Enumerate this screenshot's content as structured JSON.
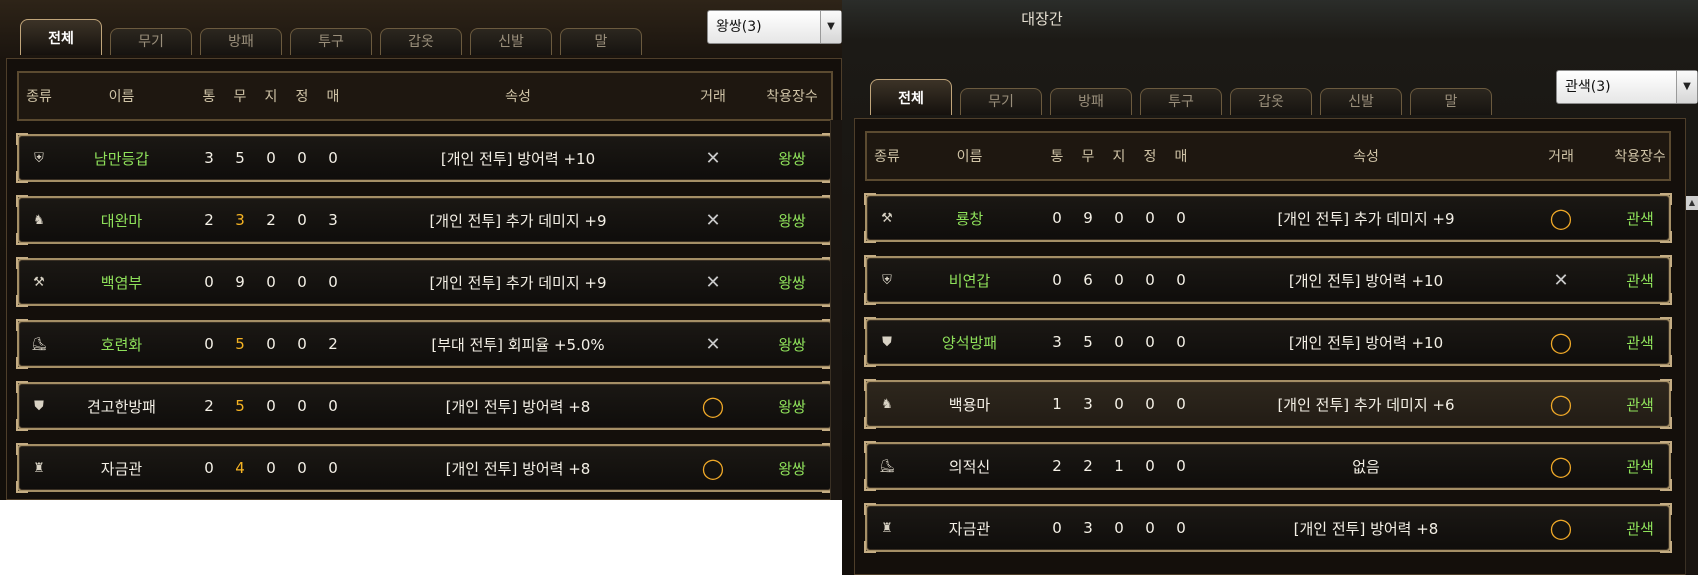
{
  "left": {
    "tabs": [
      "전체",
      "무기",
      "방패",
      "투구",
      "갑옷",
      "신발",
      "말"
    ],
    "dropdown": "왕쌍(3)",
    "headers": {
      "type": "종류",
      "name": "이름",
      "s1": "통",
      "s2": "무",
      "s3": "지",
      "s4": "정",
      "s5": "매",
      "attr": "속성",
      "trade": "거래",
      "owner": "착용장수"
    },
    "rows": [
      {
        "icon": "armor-icon",
        "name": "남만등갑",
        "green": true,
        "stats": [
          "3",
          "5",
          "0",
          "0",
          "0"
        ],
        "orange": [],
        "attr": "[개인 전투] 방어력 +10",
        "trade": "untradeable",
        "owner": "왕쌍"
      },
      {
        "icon": "horse-icon",
        "name": "대완마",
        "green": true,
        "stats": [
          "2",
          "3",
          "2",
          "0",
          "3"
        ],
        "orange": [
          1
        ],
        "attr": "[개인 전투] 추가 데미지 +9",
        "trade": "untradeable",
        "owner": "왕쌍"
      },
      {
        "icon": "weapon-icon",
        "name": "백염부",
        "green": true,
        "stats": [
          "0",
          "9",
          "0",
          "0",
          "0"
        ],
        "orange": [],
        "attr": "[개인 전투] 추가 데미지 +9",
        "trade": "untradeable",
        "owner": "왕쌍"
      },
      {
        "icon": "boots-icon",
        "name": "호련화",
        "green": true,
        "stats": [
          "0",
          "5",
          "0",
          "0",
          "2"
        ],
        "orange": [
          1
        ],
        "attr": "[부대 전투] 회피율 +5.0%",
        "trade": "untradeable",
        "owner": "왕쌍"
      },
      {
        "icon": "shield-icon",
        "name": "견고한방패",
        "green": false,
        "stats": [
          "2",
          "5",
          "0",
          "0",
          "0"
        ],
        "orange": [
          1
        ],
        "attr": "[개인 전투] 방어력 +8",
        "trade": "tradeable",
        "owner": "왕쌍"
      },
      {
        "icon": "helmet-icon",
        "name": "자금관",
        "green": false,
        "stats": [
          "0",
          "4",
          "0",
          "0",
          "0"
        ],
        "orange": [
          1
        ],
        "attr": "[개인 전투] 방어력 +8",
        "trade": "tradeable",
        "owner": "왕쌍"
      }
    ]
  },
  "right": {
    "window_title": "대장간",
    "tabs": [
      "전체",
      "무기",
      "방패",
      "투구",
      "갑옷",
      "신발",
      "말"
    ],
    "dropdown": "관색(3)",
    "headers": {
      "type": "종류",
      "name": "이름",
      "s1": "통",
      "s2": "무",
      "s3": "지",
      "s4": "정",
      "s5": "매",
      "attr": "속성",
      "trade": "거래",
      "owner": "착용장수"
    },
    "rows": [
      {
        "icon": "weapon-icon",
        "name": "룡창",
        "green": true,
        "stats": [
          "0",
          "9",
          "0",
          "0",
          "0"
        ],
        "orange": [],
        "attr": "[개인 전투] 추가 데미지 +9",
        "trade": "tradeable",
        "owner": "관색"
      },
      {
        "icon": "armor-icon",
        "name": "비연갑",
        "green": true,
        "stats": [
          "0",
          "6",
          "0",
          "0",
          "0"
        ],
        "orange": [],
        "attr": "[개인 전투] 방어력 +10",
        "trade": "untradeable",
        "owner": "관색"
      },
      {
        "icon": "shield-icon",
        "name": "양석방패",
        "green": true,
        "stats": [
          "3",
          "5",
          "0",
          "0",
          "0"
        ],
        "orange": [],
        "attr": "[개인 전투] 방어력 +10",
        "trade": "tradeable",
        "owner": "관색"
      },
      {
        "icon": "horse-icon",
        "name": "백용마",
        "green": false,
        "stats": [
          "1",
          "3",
          "0",
          "0",
          "0"
        ],
        "orange": [],
        "attr": "[개인 전투] 추가 데미지 +6",
        "trade": "tradeable",
        "owner": "관색"
      },
      {
        "icon": "boots-icon",
        "name": "의적신",
        "green": false,
        "stats": [
          "2",
          "2",
          "1",
          "0",
          "0"
        ],
        "orange": [],
        "attr": "없음",
        "trade": "tradeable",
        "owner": "관색"
      },
      {
        "icon": "helmet-icon",
        "name": "자금관",
        "green": false,
        "stats": [
          "0",
          "3",
          "0",
          "0",
          "0"
        ],
        "orange": [],
        "attr": "[개인 전투] 방어력 +8",
        "trade": "tradeable",
        "owner": "관색"
      }
    ]
  }
}
